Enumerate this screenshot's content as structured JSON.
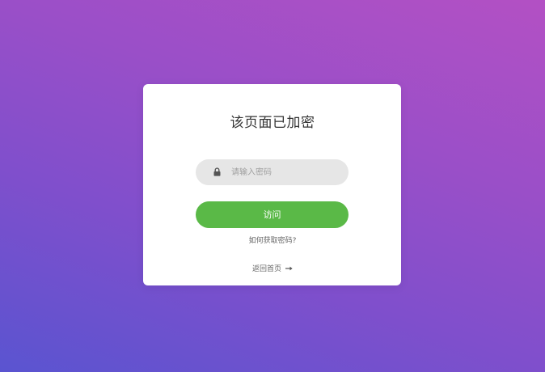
{
  "card": {
    "title": "该页面已加密"
  },
  "password": {
    "icon": "lock-icon",
    "placeholder": "请输入密码",
    "value": ""
  },
  "actions": {
    "visit_label": "访问",
    "help_label": "如何获取密码?",
    "home_label": "返回首页",
    "home_icon": "arrow-right-icon"
  },
  "colors": {
    "background_gradient": [
      "#b350c4",
      "#5a54d0"
    ],
    "card": "#ffffff",
    "input_bg": "#e6e6e6",
    "button": "#5ab947"
  }
}
